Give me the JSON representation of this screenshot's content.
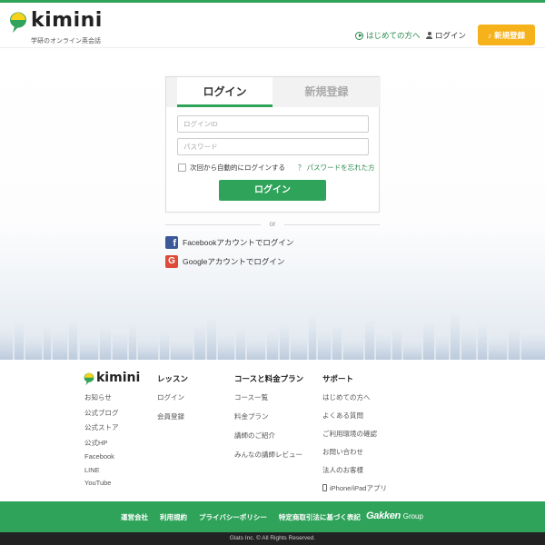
{
  "header": {
    "logo_text": "kimini",
    "tagline": "学研のオンライン英会話",
    "nav_first": "はじめての方へ",
    "nav_login": "ログイン",
    "register_button": "新規登録",
    "register_icon": "music-note-icon"
  },
  "login_form": {
    "tab_login": "ログイン",
    "tab_register": "新規登録",
    "id_placeholder": "ログインID",
    "password_placeholder": "パスワード",
    "remember_label": "次回から自動的にログインする",
    "forgot_label": "？ パスワードを忘れた方",
    "submit_label": "ログイン"
  },
  "divider_text": "or",
  "social": {
    "facebook_label": "Facebookアカウントでログイン",
    "google_label": "Googleアカウントでログイン"
  },
  "footer": {
    "logo_text": "kimini",
    "about_links": [
      "お知らせ",
      "公式ブログ",
      "公式ストア",
      "公式HP",
      "Facebook",
      "LINE",
      "YouTube"
    ],
    "lesson": {
      "heading": "レッスン",
      "links": [
        "ログイン",
        "会員登録"
      ]
    },
    "course": {
      "heading": "コースと料金プラン",
      "links": [
        "コース一覧",
        "料金プラン",
        "講師のご紹介",
        "みんなの講師レビュー"
      ]
    },
    "support": {
      "heading": "サポート",
      "links": [
        "はじめての方へ",
        "よくある質問",
        "ご利用環境の確認",
        "お問い合わせ",
        "法人のお客様",
        "iPhone/iPadアプリ"
      ]
    }
  },
  "green_bar": {
    "links": [
      "運営会社",
      "利用規約",
      "プライバシーポリシー",
      "特定商取引法に基づく表記"
    ],
    "group_logo": "Gakken",
    "group_suffix": "Group"
  },
  "copyright": "Glats Inc. © All Rights Reserved.",
  "colors": {
    "brand_green": "#2fa35a",
    "accent_yellow": "#f6b21a",
    "facebook": "#3b5998",
    "google": "#dd4b39"
  }
}
